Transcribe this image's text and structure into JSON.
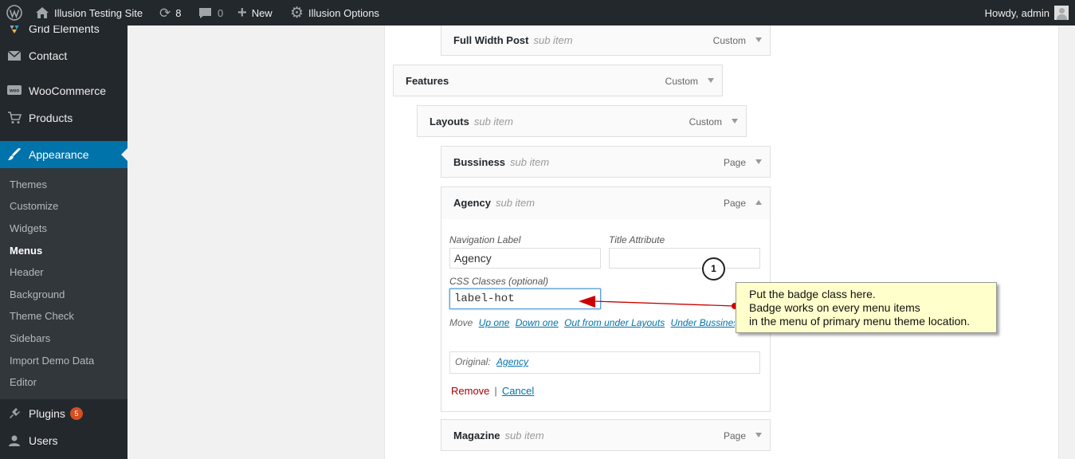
{
  "adminbar": {
    "site_name": "Illusion Testing Site",
    "updates_count": "8",
    "comments_count": "0",
    "new_label": "New",
    "options_label": "Illusion Options",
    "howdy": "Howdy, admin"
  },
  "sidebar": {
    "items": [
      {
        "label": "Grid Elements",
        "icon": "grid-icon"
      },
      {
        "label": "Contact",
        "icon": "mail-icon"
      },
      {
        "label": "WooCommerce",
        "icon": "woo-icon"
      },
      {
        "label": "Products",
        "icon": "cart-icon"
      },
      {
        "label": "Appearance",
        "icon": "brush-icon"
      },
      {
        "label": "Plugins",
        "icon": "plug-icon",
        "badge": "5"
      },
      {
        "label": "Users",
        "icon": "user-icon"
      }
    ],
    "submenu": [
      "Themes",
      "Customize",
      "Widgets",
      "Menus",
      "Header",
      "Background",
      "Theme Check",
      "Sidebars",
      "Import Demo Data",
      "Editor"
    ]
  },
  "menu_items": [
    {
      "title": "Full Width Post",
      "sub": "sub item",
      "type": "Custom"
    },
    {
      "title": "Features",
      "sub": "",
      "type": "Custom"
    },
    {
      "title": "Layouts",
      "sub": "sub item",
      "type": "Custom"
    },
    {
      "title": "Bussiness",
      "sub": "sub item",
      "type": "Page"
    },
    {
      "title": "Agency",
      "sub": "sub item",
      "type": "Page"
    },
    {
      "title": "Magazine",
      "sub": "sub item",
      "type": "Page"
    }
  ],
  "settings": {
    "nav_label_label": "Navigation Label",
    "nav_label_value": "Agency",
    "title_attr_label": "Title Attribute",
    "title_attr_value": "",
    "css_label": "CSS Classes (optional)",
    "css_value": "label-hot",
    "move_label": "Move",
    "move_links": [
      "Up one",
      "Down one",
      "Out from under Layouts",
      "Under Bussiness"
    ],
    "original_label": "Original:",
    "original_link": "Agency",
    "remove": "Remove",
    "separator": "|",
    "cancel": "Cancel"
  },
  "annotation": {
    "number": "1",
    "lines": [
      "Put the badge class here.",
      "Badge works on every menu items",
      "in the menu of primary menu theme location."
    ],
    "arrow_color": "#cc0000"
  },
  "colors": {
    "accent": "#0073aa",
    "badge": "#d54e21",
    "callout_bg": "#ffffcc"
  }
}
